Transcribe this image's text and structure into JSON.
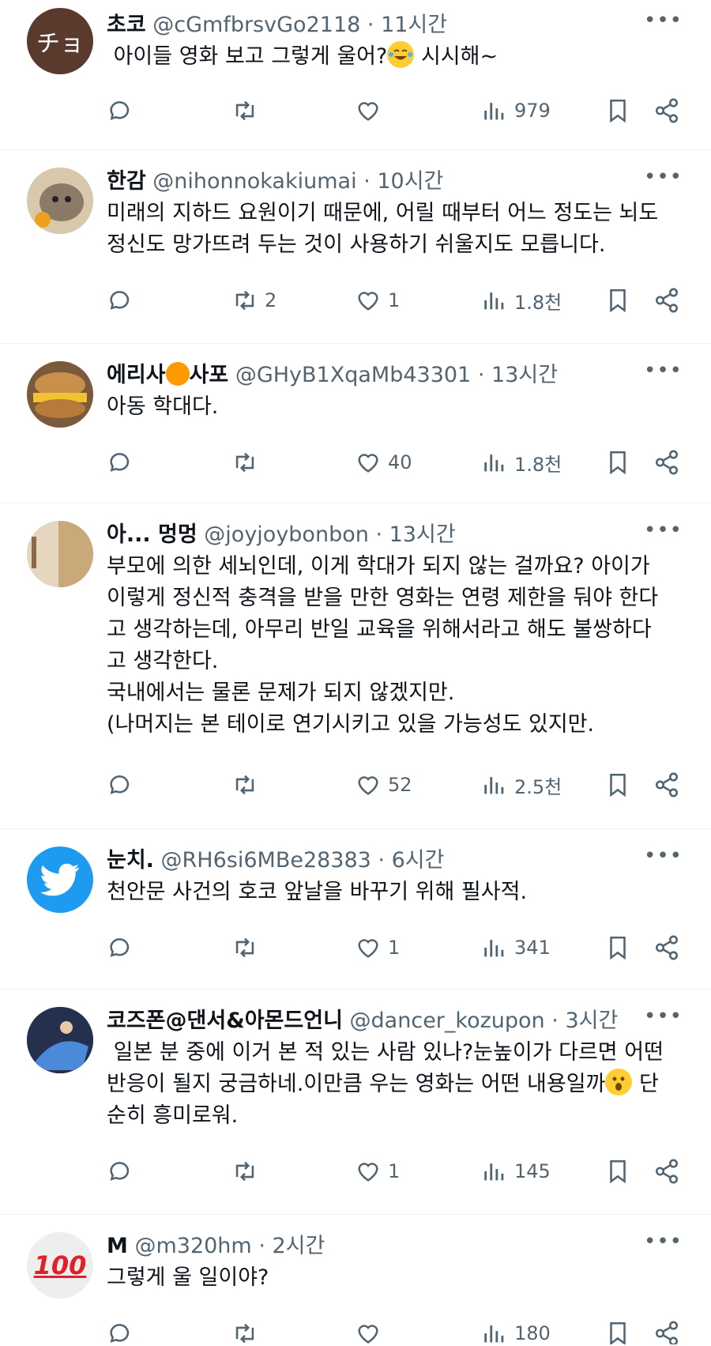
{
  "tweets": [
    {
      "name": "초코",
      "handle": "@cGmfbrsvGo2118",
      "time": "11시간",
      "text_parts": [
        "아이들 영화 보고 그렇게 울어?",
        "시시해~"
      ],
      "reply": "",
      "retweet": "",
      "like": "",
      "views": "979",
      "avatar_text": "チョ"
    },
    {
      "name": "한감",
      "handle": "@nihonnokakiumai",
      "time": "10시간",
      "text": "미래의 지하드 요원이기 때문에, 어릴 때부터 어느 정도는 뇌도\n정신도 망가뜨려 두는 것이 사용하기 쉬울지도 모릅니다.",
      "reply": "",
      "retweet": "2",
      "like": "1",
      "views": "1.8천"
    },
    {
      "name_a": "에리사",
      "name_b": "사포",
      "handle": "@GHyB1XqaMb43301",
      "time": "13시간",
      "text": "아동 학대다.",
      "reply": "",
      "retweet": "",
      "like": "40",
      "views": "1.8천"
    },
    {
      "name": "아... 멍멍",
      "handle": "@joyjoybonbon",
      "time": "13시간",
      "text": "부모에 의한 세뇌인데, 이게 학대가 되지 않는 걸까요? 아이가\n이렇게 정신적 충격을 받을 만한 영화는 연령 제한을 둬야 한다\n고 생각하는데, 아무리 반일 교육을 위해서라고 해도 불쌍하다\n고 생각한다.\n국내에서는 물론 문제가 되지 않겠지만.\n(나머지는 본 테이로 연기시키고 있을 가능성도 있지만.",
      "reply": "",
      "retweet": "",
      "like": "52",
      "views": "2.5천"
    },
    {
      "name": "눈치.",
      "handle": "@RH6si6MBe28383",
      "time": "6시간",
      "text": "천안문 사건의 호코 앞날을 바꾸기 위해 필사적.",
      "reply": "",
      "retweet": "",
      "like": "1",
      "views": "341"
    },
    {
      "name": "코즈폰@댄서&아몬드언니",
      "handle": "@dancer_kozupon",
      "time": "3시간",
      "text_a": " 일본 분 중에 이거 본 적 있는 사람 있나?눈높이가 다르면 어떤\n반응이 될지 궁금하네.이만큼 우는 영화는 어떤 내용일까",
      "text_b": " 단\n순히 흥미로워.",
      "reply": "",
      "retweet": "",
      "like": "1",
      "views": "145"
    },
    {
      "name": "M",
      "handle": "@m320hm",
      "time": "2시간",
      "text": "그렇게 울 일이야?",
      "avatar_text": "100",
      "reply": "",
      "retweet": "",
      "like": "",
      "views": "180"
    }
  ],
  "separator": "·",
  "more_glyph": "•••",
  "colors": {
    "muted": "#536471",
    "text": "#0f1419",
    "twitter_blue": "#1d9bf0"
  }
}
